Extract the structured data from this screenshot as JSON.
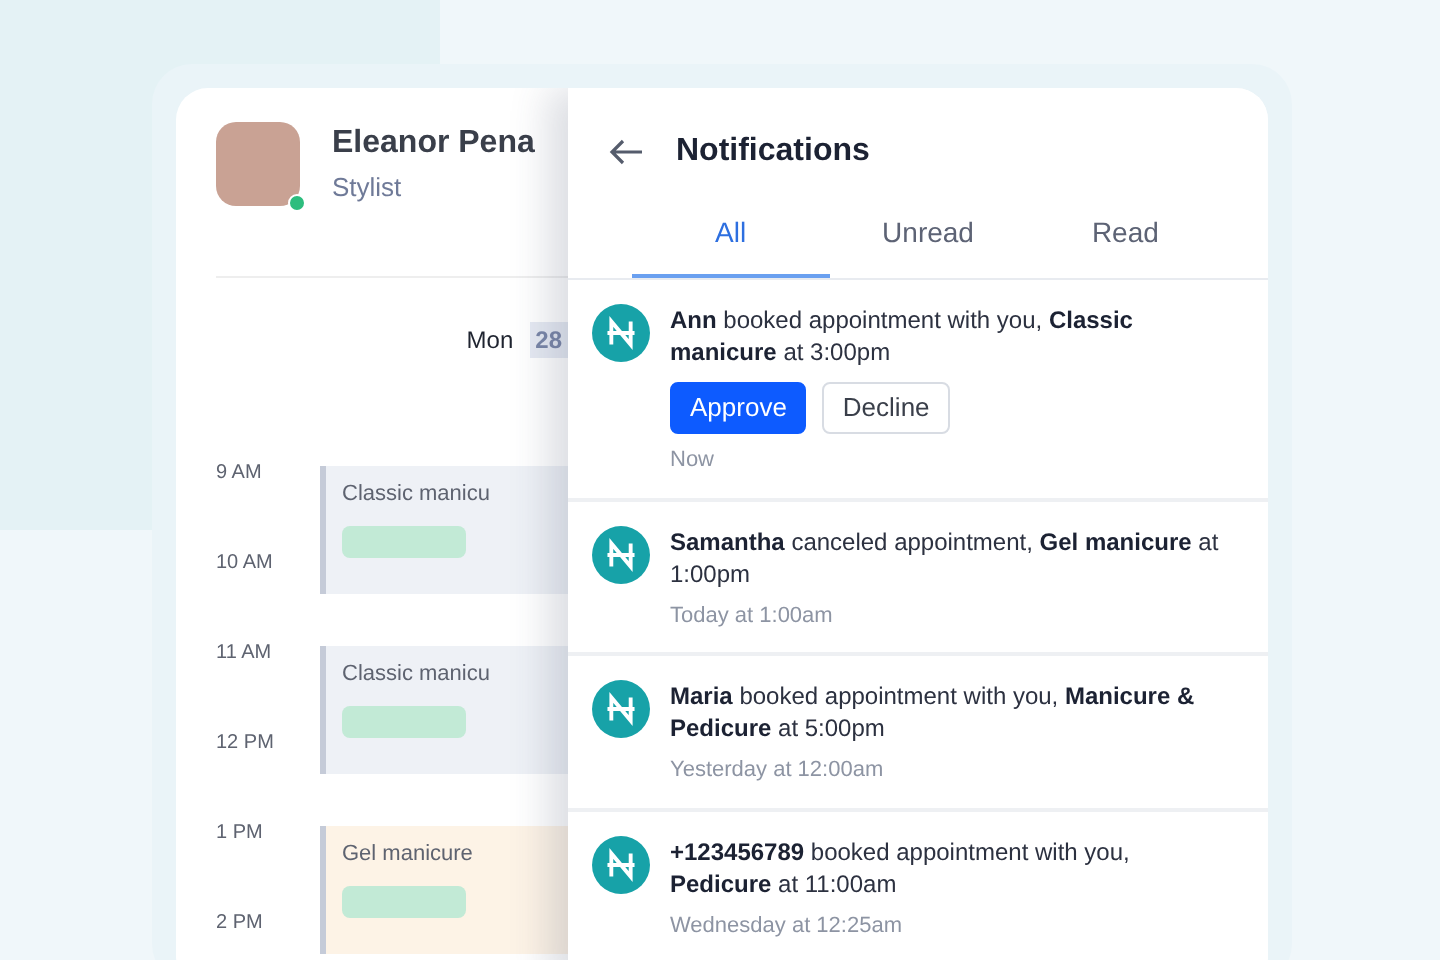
{
  "profile": {
    "name": "Eleanor Pena",
    "role": "Stylist",
    "online": true
  },
  "calendar": {
    "day": "Mon",
    "date": "28",
    "times": [
      "9 AM",
      "10 AM",
      "11 AM",
      "12 PM",
      "1 PM",
      "2 PM"
    ],
    "events": [
      {
        "title": "Classic manicu",
        "color": "#eef1f6"
      },
      {
        "title": "Classic manicu",
        "color": "#eef1f6"
      },
      {
        "title": "Gel manicure",
        "color": "#fdf3e6"
      }
    ]
  },
  "panel": {
    "title": "Notifications",
    "tabs": [
      {
        "label": "All",
        "selected": true
      },
      {
        "label": "Unread",
        "selected": false
      },
      {
        "label": "Read",
        "selected": false
      }
    ],
    "notifications": [
      {
        "text": "**Ann** booked appointment with you, **Classic manicure** at 3:00pm",
        "time": "Now",
        "actions": [
          {
            "label": "Approve",
            "kind": "primary"
          },
          {
            "label": "Decline",
            "kind": "secondary"
          }
        ]
      },
      {
        "text": "**Samantha** canceled appointment, **Gel manicure** at 1:00pm",
        "time": "Today at 1:00am"
      },
      {
        "text": "**Maria** booked appointment with you, **Manicure & Pedicure** at 5:00pm",
        "time": "Yesterday at 12:00am"
      },
      {
        "text": "**+123456789** booked appointment with you, **Pedicure** at 11:00am",
        "time": "Wednesday at 12:25am"
      }
    ]
  }
}
